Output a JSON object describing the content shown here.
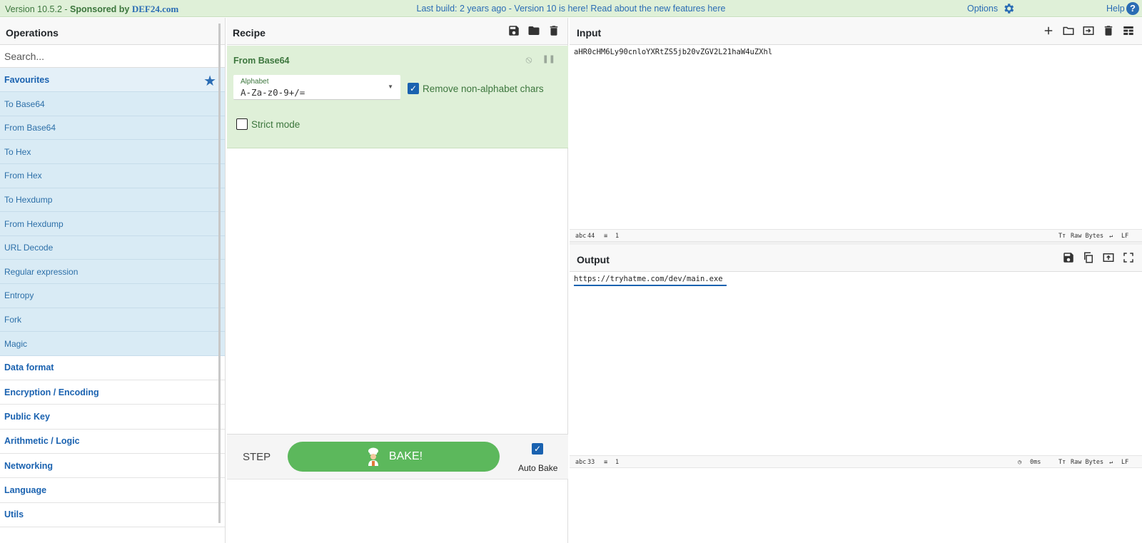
{
  "banner": {
    "version": "Version 10.5.2 - ",
    "sponsored_by": "Sponsored by ",
    "sponsor": "DEF24.com",
    "news": "Last build: 2 years ago - Version 10 is here! Read about the new features here",
    "options": "Options",
    "help": "Help"
  },
  "operations": {
    "title": "Operations",
    "search_placeholder": "Search...",
    "favourites_label": "Favourites",
    "favourites": [
      "To Base64",
      "From Base64",
      "To Hex",
      "From Hex",
      "To Hexdump",
      "From Hexdump",
      "URL Decode",
      "Regular expression",
      "Entropy",
      "Fork",
      "Magic"
    ],
    "categories": [
      "Data format",
      "Encryption / Encoding",
      "Public Key",
      "Arithmetic / Logic",
      "Networking",
      "Language",
      "Utils"
    ]
  },
  "recipe": {
    "title": "Recipe",
    "operation": {
      "name": "From Base64",
      "alphabet_label": "Alphabet",
      "alphabet_value": "A-Za-z0-9+/=",
      "remove_nonalpha_label": "Remove non-alphabet chars",
      "remove_nonalpha_checked": true,
      "strict_mode_label": "Strict mode",
      "strict_mode_checked": false
    },
    "step_label": "STEP",
    "bake_label": "BAKE!",
    "auto_bake_label": "Auto Bake",
    "auto_bake_checked": true
  },
  "input": {
    "title": "Input",
    "text": "aHR0cHM6Ly90cnloYXRtZS5jb20vZGV2L21haW4uZXhl",
    "length": "44",
    "lines": "1",
    "encoding": "Raw Bytes",
    "eol": "LF"
  },
  "output": {
    "title": "Output",
    "text": "https://tryhatme.com/dev/main.exe",
    "length": "33",
    "lines": "1",
    "time": "0ms",
    "encoding": "Raw Bytes",
    "eol": "LF"
  },
  "colors": {
    "banner_bg": "#dff0d8",
    "favourite_bg": "#d9ebf5",
    "operation_bg": "#dff0d8",
    "bake_button": "#5cb85c",
    "link_blue": "#1a62b0"
  }
}
